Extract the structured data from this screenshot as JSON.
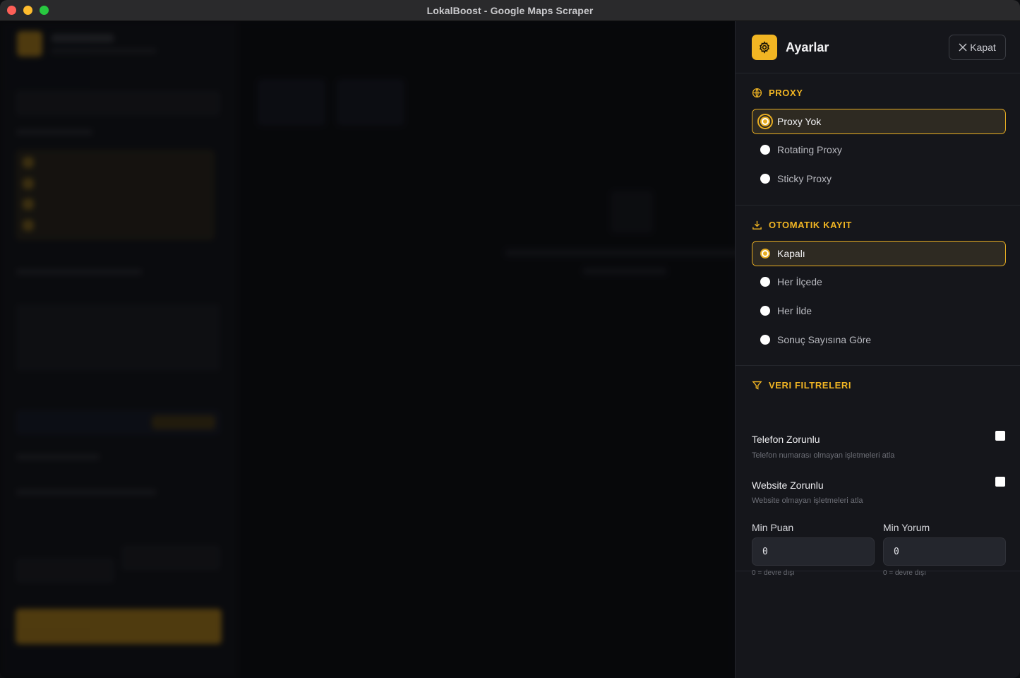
{
  "window": {
    "title": "LokalBoost - Google Maps Scraper"
  },
  "panel": {
    "title": "Ayarlar",
    "close_label": "Kapat",
    "proxy": {
      "heading": "PROXY",
      "options": [
        "Proxy Yok",
        "Rotating Proxy",
        "Sticky Proxy"
      ],
      "selected": "Proxy Yok"
    },
    "autosave": {
      "heading": "OTOMATIK KAYIT",
      "options": [
        "Kapalı",
        "Her İlçede",
        "Her İlde",
        "Sonuç Sayısına Göre"
      ],
      "selected": "Kapalı"
    },
    "filters": {
      "heading": "VERI FILTRELERI",
      "phone_required": {
        "label": "Telefon Zorunlu",
        "desc": "Telefon numarası olmayan işletmeleri atla",
        "checked": false
      },
      "website_required": {
        "label": "Website Zorunlu",
        "desc": "Website olmayan işletmeleri atla",
        "checked": false
      },
      "min_rating": {
        "label": "Min Puan",
        "value": "0",
        "hint": "0 = devre dışı"
      },
      "min_reviews": {
        "label": "Min Yorum",
        "value": "0",
        "hint": "0 = devre dışı"
      }
    }
  },
  "colors": {
    "accent": "#f1b523",
    "panel_bg": "#15161b",
    "window_bg": "#0b0c10"
  }
}
